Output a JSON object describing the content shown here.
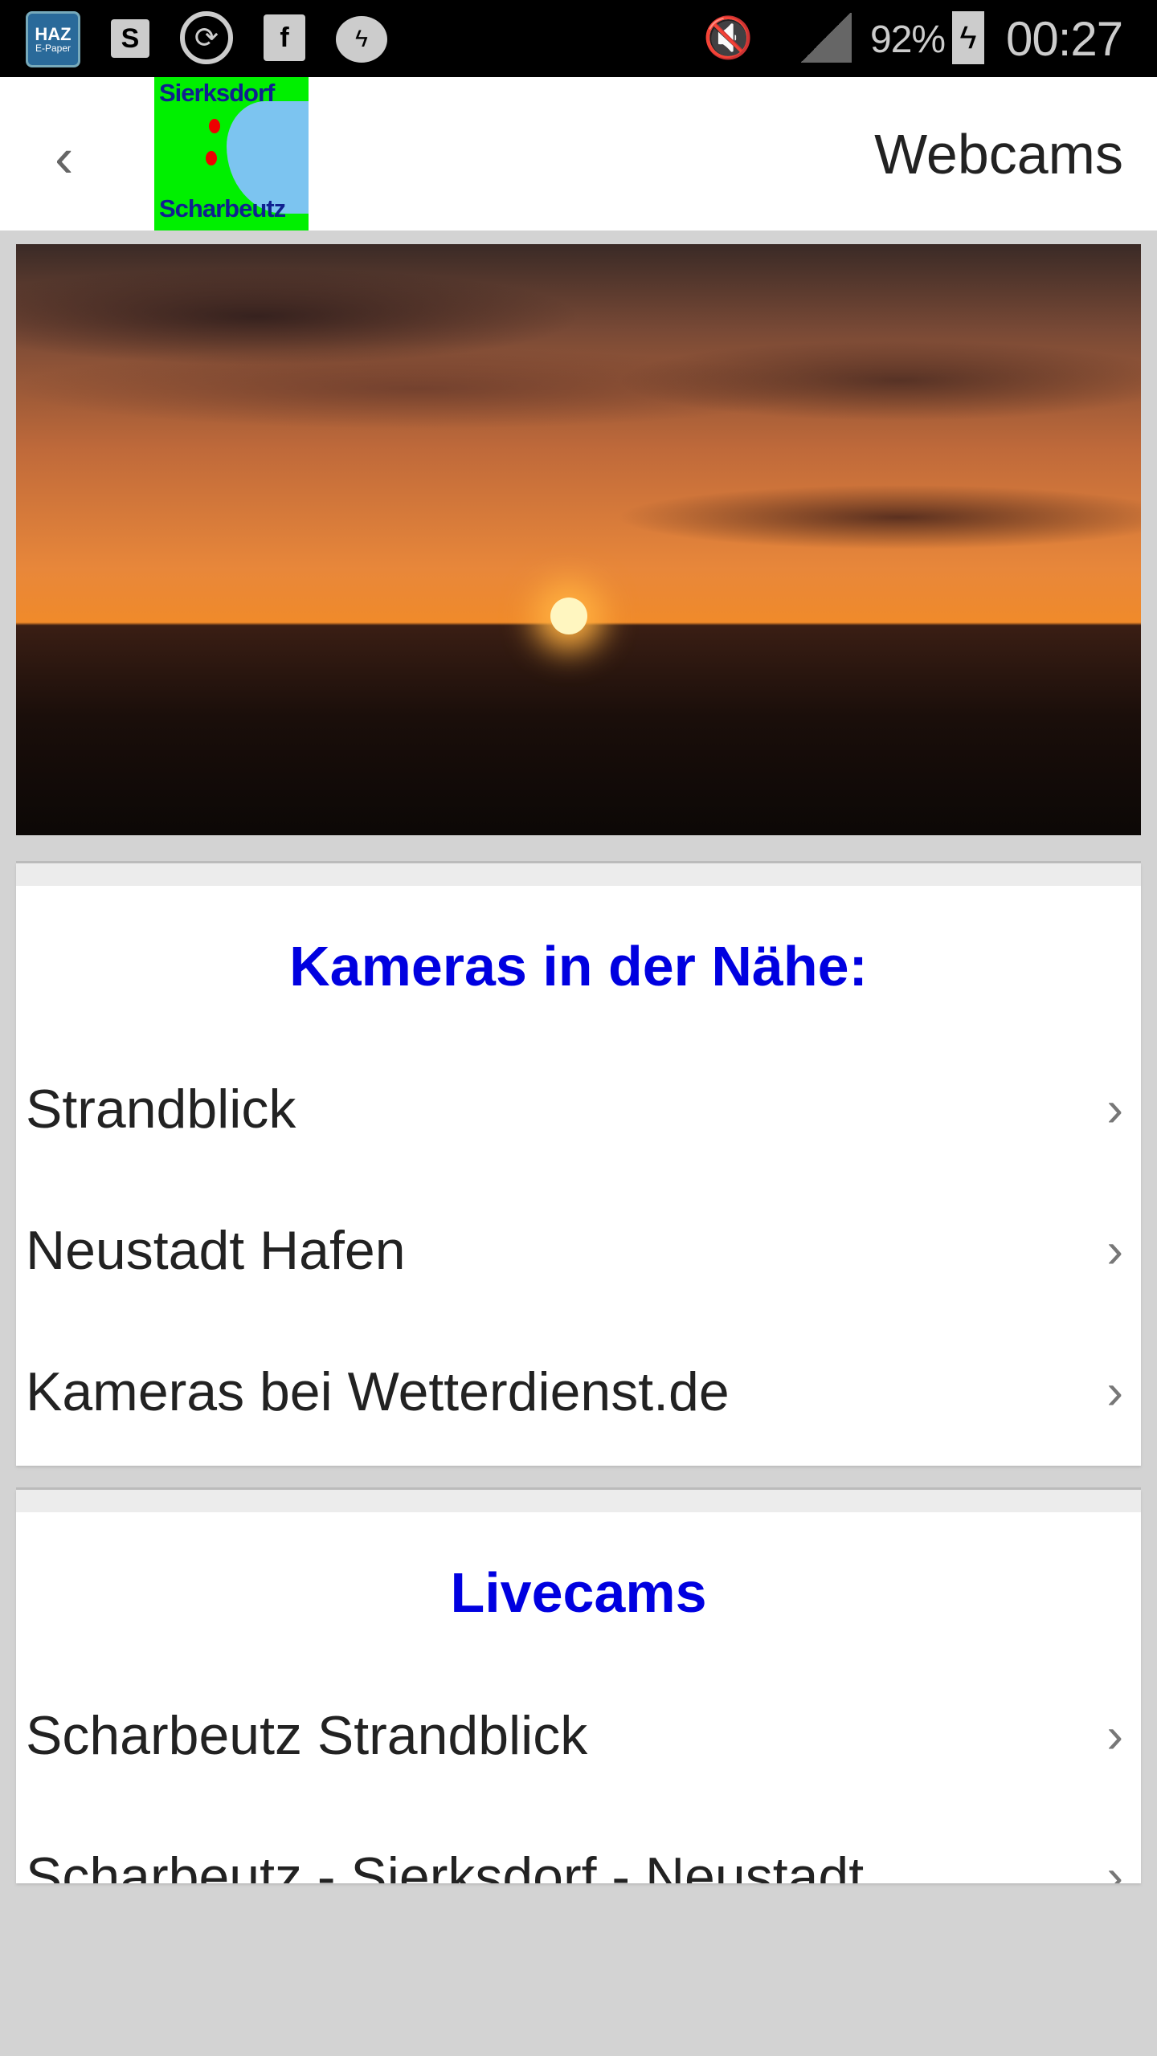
{
  "status_bar": {
    "notifications": [
      "haz-epaper-icon",
      "skype-icon",
      "sync-icon",
      "facebook-icon",
      "messenger-icon"
    ],
    "haz_label": "HAZ",
    "haz_sub": "E-Paper",
    "battery": "92%",
    "time": "00:27"
  },
  "header": {
    "title": "Webcams",
    "logo_top": "Sierksdorf",
    "logo_bottom": "Scharbeutz"
  },
  "sections": [
    {
      "heading": "Kameras in der Nähe:",
      "items": [
        "Strandblick",
        "Neustadt Hafen",
        "Kameras bei Wetterdienst.de"
      ]
    },
    {
      "heading": "Livecams",
      "items": [
        "Scharbeutz Strandblick",
        "Scharbeutz - Sierksdorf - Neustadt"
      ]
    }
  ],
  "colors": {
    "heading": "#0000e0",
    "logo_bg": "#00f000"
  }
}
